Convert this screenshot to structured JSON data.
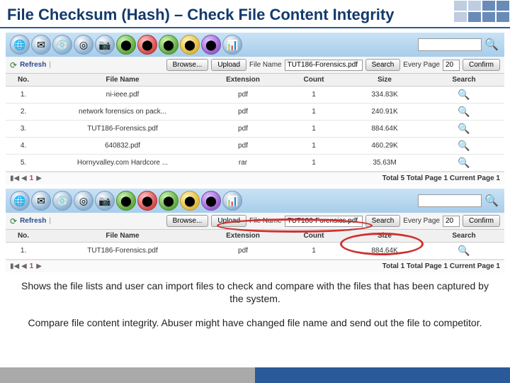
{
  "title": "File Checksum (Hash) – Check File Content Integrity",
  "toolbar_icons": [
    "globe",
    "mail",
    "disc",
    "target",
    "camera",
    "green",
    "red",
    "green2",
    "yellow",
    "purple",
    "chart"
  ],
  "controls": {
    "refresh": "Refresh",
    "browse": "Browse...",
    "upload": "Upload",
    "filename_label": "File Name",
    "filename_value": "TUT186-Forensics.pdf",
    "search": "Search",
    "every_page": "Every Page",
    "page_size": "20",
    "confirm": "Confirm"
  },
  "headers": {
    "no": "No.",
    "filename": "File Name",
    "ext": "Extension",
    "count": "Count",
    "size": "Size",
    "search": "Search"
  },
  "table1": [
    {
      "no": "1.",
      "name": "ni-ieee.pdf",
      "ext": "pdf",
      "count": "1",
      "size": "334.83K"
    },
    {
      "no": "2.",
      "name": "network forensics on pack...",
      "ext": "pdf",
      "count": "1",
      "size": "240.91K"
    },
    {
      "no": "3.",
      "name": "TUT186-Forensics.pdf",
      "ext": "pdf",
      "count": "1",
      "size": "884.64K"
    },
    {
      "no": "4.",
      "name": "640832.pdf",
      "ext": "pdf",
      "count": "1",
      "size": "460.29K"
    },
    {
      "no": "5.",
      "name": "Hornyvalley.com Hardcore ...",
      "ext": "rar",
      "count": "1",
      "size": "35.63M"
    }
  ],
  "pager1": {
    "page": "1",
    "status": "Total 5  Total Page 1  Current Page 1"
  },
  "table2": [
    {
      "no": "1.",
      "name": "TUT186-Forensics.pdf",
      "ext": "pdf",
      "count": "1",
      "size": "884.64K"
    }
  ],
  "pager2": {
    "page": "1",
    "status": "Total 1  Total Page 1  Current Page 1"
  },
  "caption1": "Shows the file lists and user can import files to check and compare with the files that has been captured by the system.",
  "caption2": "Compare file content integrity. Abuser might have changed file name and send out the file to competitor."
}
